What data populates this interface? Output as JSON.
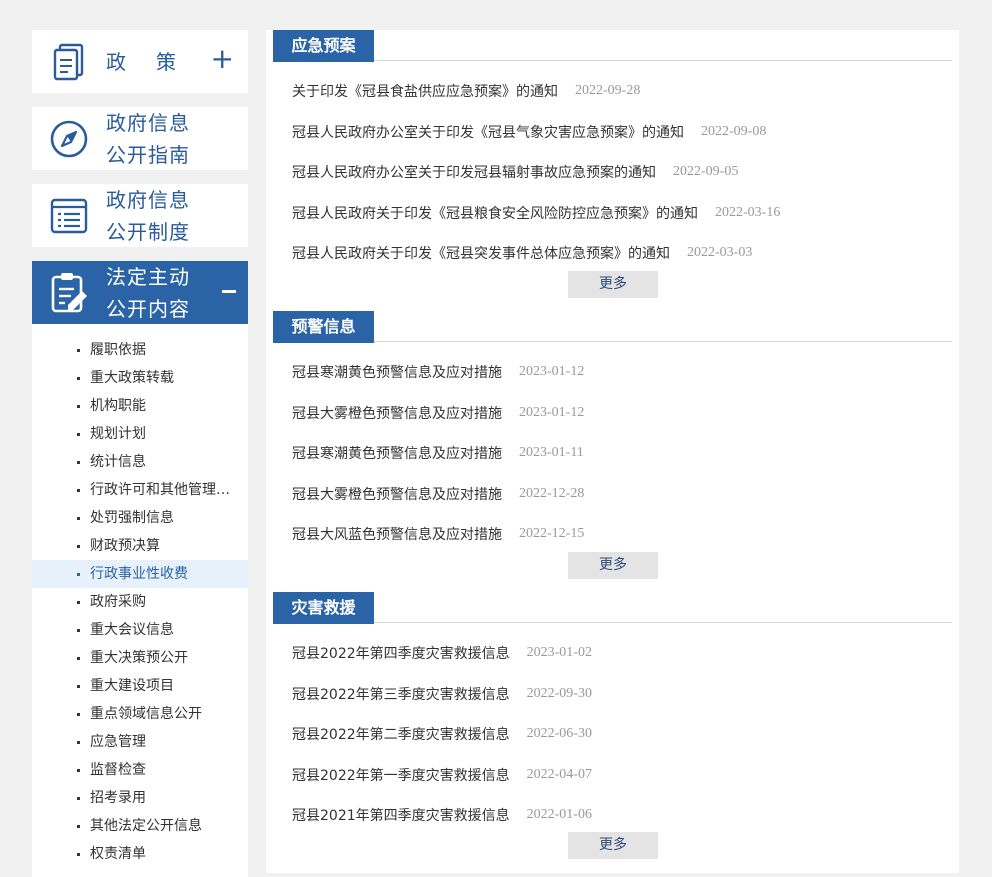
{
  "sidebar": {
    "cards": [
      {
        "label": "政策",
        "icon": "book-icon",
        "toggle": "+"
      },
      {
        "label": "政府信息公开指南",
        "line1": "政府信息",
        "line2": "公开指南",
        "icon": "compass-icon"
      },
      {
        "label": "政府信息公开制度",
        "line1": "政府信息",
        "line2": "公开制度",
        "icon": "list-document-icon"
      },
      {
        "label": "法定主动公开内容",
        "line1": "法定主动",
        "line2": "公开内容",
        "icon": "clipboard-edit-icon",
        "toggle": "-"
      }
    ],
    "policy_chars": [
      "政",
      "策"
    ],
    "subitems": [
      "履职依据",
      "重大政策转载",
      "机构职能",
      "规划计划",
      "统计信息",
      "行政许可和其他管理服...",
      "处罚强制信息",
      "财政预决算",
      "行政事业性收费",
      "政府采购",
      "重大会议信息",
      "重大决策预公开",
      "重大建设项目",
      "重点领域信息公开",
      "应急管理",
      "监督检查",
      "招考录用",
      "其他法定公开信息",
      "权责清单"
    ],
    "selected_index": 8
  },
  "sections": [
    {
      "title": "应急预案",
      "items": [
        {
          "title": "关于印发《冠县食盐供应应急预案》的通知",
          "date": "2022-09-28"
        },
        {
          "title": "冠县人民政府办公室关于印发《冠县气象灾害应急预案》的通知",
          "date": "2022-09-08"
        },
        {
          "title": "冠县人民政府办公室关于印发冠县辐射事故应急预案的通知",
          "date": "2022-09-05"
        },
        {
          "title": "冠县人民政府关于印发《冠县粮食安全风险防控应急预案》的通知",
          "date": "2022-03-16"
        },
        {
          "title": "冠县人民政府关于印发《冠县突发事件总体应急预案》的通知",
          "date": "2022-03-03"
        }
      ],
      "more": "更多"
    },
    {
      "title": "预警信息",
      "items": [
        {
          "title": "冠县寒潮黄色预警信息及应对措施",
          "date": "2023-01-12"
        },
        {
          "title": "冠县大雾橙色预警信息及应对措施",
          "date": "2023-01-12"
        },
        {
          "title": "冠县寒潮黄色预警信息及应对措施",
          "date": "2023-01-11"
        },
        {
          "title": "冠县大雾橙色预警信息及应对措施",
          "date": "2022-12-28"
        },
        {
          "title": "冠县大风蓝色预警信息及应对措施",
          "date": "2022-12-15"
        }
      ],
      "more": "更多"
    },
    {
      "title": "灾害救援",
      "items": [
        {
          "title": "冠县2022年第四季度灾害救援信息",
          "date": "2023-01-02"
        },
        {
          "title": "冠县2022年第三季度灾害救援信息",
          "date": "2022-09-30"
        },
        {
          "title": "冠县2022年第二季度灾害救援信息",
          "date": "2022-06-30"
        },
        {
          "title": "冠县2022年第一季度灾害救援信息",
          "date": "2022-04-07"
        },
        {
          "title": "冠县2021年第四季度灾害救援信息",
          "date": "2022-01-06"
        }
      ],
      "more": "更多"
    }
  ],
  "colors": {
    "accent": "#2a63a6",
    "background": "#f1f1f1",
    "date": "#999999"
  }
}
